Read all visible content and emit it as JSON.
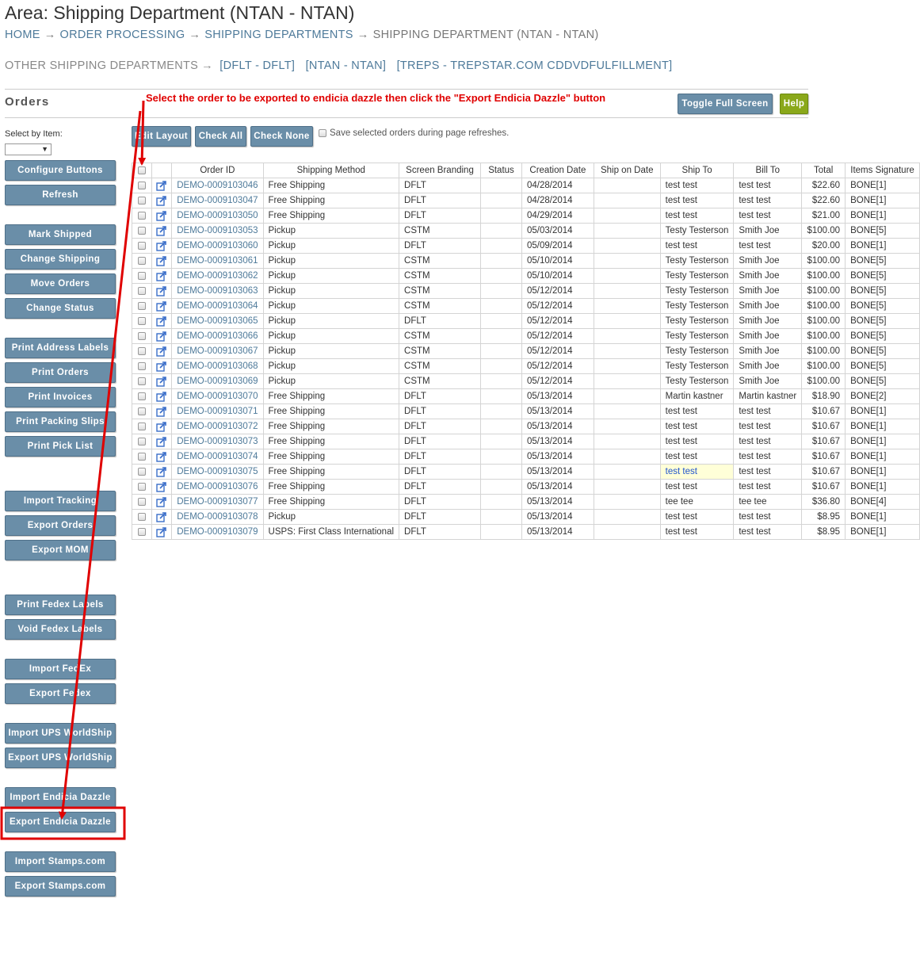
{
  "page": {
    "title": "Area: Shipping Department (NTAN - NTAN)",
    "breadcrumb": [
      "HOME",
      "ORDER PROCESSING",
      "SHIPPING DEPARTMENTS",
      "SHIPPING DEPARTMENT (NTAN - NTAN)"
    ],
    "separator": "→"
  },
  "other_departments": {
    "label": "OTHER SHIPPING DEPARTMENTS",
    "items": [
      "[DFLT - DFLT]",
      "[NTAN - NTAN]",
      "[TREPS - TREPSTAR.COM CDDVDFULFILLMENT]"
    ]
  },
  "orders_heading": "Orders",
  "instruction": "Select the order to be exported to endicia dazzle then click the \"Export Endicia Dazzle\" button",
  "top_buttons": {
    "toggle_full_screen": "Toggle Full Screen",
    "help": "Help"
  },
  "select_by_item": {
    "label": "Select by Item:",
    "value": ""
  },
  "toolbar": {
    "edit_layout": "Edit Layout",
    "check_all": "Check All",
    "check_none": "Check None",
    "save_selected": "Save selected orders during page refreshes."
  },
  "sidebar": {
    "configure_buttons": "Configure Buttons",
    "refresh": "Refresh",
    "mark_shipped": "Mark Shipped",
    "change_shipping": "Change Shipping",
    "move_orders": "Move Orders",
    "change_status": "Change Status",
    "print_address_labels": "Print Address Labels",
    "print_orders": "Print Orders",
    "print_invoices": "Print Invoices",
    "print_packing_slips": "Print Packing Slips",
    "print_pick_list": "Print Pick List",
    "import_tracking": "Import Tracking",
    "export_orders": "Export Orders",
    "export_mom": "Export MOM",
    "print_fedex_labels": "Print Fedex Labels",
    "void_fedex_labels": "Void Fedex Labels",
    "import_fedex": "Import FedEx",
    "export_fedex": "Export Fedex",
    "import_ups_worldship": "Import UPS WorldShip",
    "export_ups_worldship": "Export UPS WorldShip",
    "import_endicia_dazzle": "Import Endicia Dazzle",
    "export_endicia_dazzle": "Export Endicia Dazzle",
    "import_stamps": "Import Stamps.com",
    "export_stamps": "Export Stamps.com"
  },
  "table": {
    "columns": [
      "Order ID",
      "Shipping Method",
      "Screen Branding",
      "Status",
      "Creation Date",
      "Ship on Date",
      "Ship To",
      "Bill To",
      "Total",
      "Items Signature"
    ],
    "rows": [
      [
        "DEMO-0009103046",
        "Free Shipping",
        "DFLT",
        "",
        "04/28/2014",
        "",
        "test test",
        "test test",
        "$22.60",
        "BONE[1]"
      ],
      [
        "DEMO-0009103047",
        "Free Shipping",
        "DFLT",
        "",
        "04/28/2014",
        "",
        "test test",
        "test test",
        "$22.60",
        "BONE[1]"
      ],
      [
        "DEMO-0009103050",
        "Free Shipping",
        "DFLT",
        "",
        "04/29/2014",
        "",
        "test test",
        "test test",
        "$21.00",
        "BONE[1]"
      ],
      [
        "DEMO-0009103053",
        "Pickup",
        "CSTM",
        "",
        "05/03/2014",
        "",
        "Testy Testerson",
        "Smith Joe",
        "$100.00",
        "BONE[5]"
      ],
      [
        "DEMO-0009103060",
        "Pickup",
        "DFLT",
        "",
        "05/09/2014",
        "",
        "test test",
        "test test",
        "$20.00",
        "BONE[1]"
      ],
      [
        "DEMO-0009103061",
        "Pickup",
        "CSTM",
        "",
        "05/10/2014",
        "",
        "Testy Testerson",
        "Smith Joe",
        "$100.00",
        "BONE[5]"
      ],
      [
        "DEMO-0009103062",
        "Pickup",
        "CSTM",
        "",
        "05/10/2014",
        "",
        "Testy Testerson",
        "Smith Joe",
        "$100.00",
        "BONE[5]"
      ],
      [
        "DEMO-0009103063",
        "Pickup",
        "CSTM",
        "",
        "05/12/2014",
        "",
        "Testy Testerson",
        "Smith Joe",
        "$100.00",
        "BONE[5]"
      ],
      [
        "DEMO-0009103064",
        "Pickup",
        "CSTM",
        "",
        "05/12/2014",
        "",
        "Testy Testerson",
        "Smith Joe",
        "$100.00",
        "BONE[5]"
      ],
      [
        "DEMO-0009103065",
        "Pickup",
        "DFLT",
        "",
        "05/12/2014",
        "",
        "Testy Testerson",
        "Smith Joe",
        "$100.00",
        "BONE[5]"
      ],
      [
        "DEMO-0009103066",
        "Pickup",
        "CSTM",
        "",
        "05/12/2014",
        "",
        "Testy Testerson",
        "Smith Joe",
        "$100.00",
        "BONE[5]"
      ],
      [
        "DEMO-0009103067",
        "Pickup",
        "CSTM",
        "",
        "05/12/2014",
        "",
        "Testy Testerson",
        "Smith Joe",
        "$100.00",
        "BONE[5]"
      ],
      [
        "DEMO-0009103068",
        "Pickup",
        "CSTM",
        "",
        "05/12/2014",
        "",
        "Testy Testerson",
        "Smith Joe",
        "$100.00",
        "BONE[5]"
      ],
      [
        "DEMO-0009103069",
        "Pickup",
        "CSTM",
        "",
        "05/12/2014",
        "",
        "Testy Testerson",
        "Smith Joe",
        "$100.00",
        "BONE[5]"
      ],
      [
        "DEMO-0009103070",
        "Free Shipping",
        "DFLT",
        "",
        "05/13/2014",
        "",
        "Martin kastner",
        "Martin kastner",
        "$18.90",
        "BONE[2]"
      ],
      [
        "DEMO-0009103071",
        "Free Shipping",
        "DFLT",
        "",
        "05/13/2014",
        "",
        "test test",
        "test test",
        "$10.67",
        "BONE[1]"
      ],
      [
        "DEMO-0009103072",
        "Free Shipping",
        "DFLT",
        "",
        "05/13/2014",
        "",
        "test test",
        "test test",
        "$10.67",
        "BONE[1]"
      ],
      [
        "DEMO-0009103073",
        "Free Shipping",
        "DFLT",
        "",
        "05/13/2014",
        "",
        "test test",
        "test test",
        "$10.67",
        "BONE[1]"
      ],
      [
        "DEMO-0009103074",
        "Free Shipping",
        "DFLT",
        "",
        "05/13/2014",
        "",
        "test test",
        "test test",
        "$10.67",
        "BONE[1]"
      ],
      [
        "DEMO-0009103075",
        "Free Shipping",
        "DFLT",
        "",
        "05/13/2014",
        "",
        "test test",
        "test test",
        "$10.67",
        "BONE[1]"
      ],
      [
        "DEMO-0009103076",
        "Free Shipping",
        "DFLT",
        "",
        "05/13/2014",
        "",
        "test test",
        "test test",
        "$10.67",
        "BONE[1]"
      ],
      [
        "DEMO-0009103077",
        "Free Shipping",
        "DFLT",
        "",
        "05/13/2014",
        "",
        "tee tee",
        "tee tee",
        "$36.80",
        "BONE[4]"
      ],
      [
        "DEMO-0009103078",
        "Pickup",
        "DFLT",
        "",
        "05/13/2014",
        "",
        "test test",
        "test test",
        "$8.95",
        "BONE[1]"
      ],
      [
        "DEMO-0009103079",
        "USPS: First Class International",
        "DFLT",
        "",
        "05/13/2014",
        "",
        "test test",
        "test test",
        "$8.95",
        "BONE[1]"
      ]
    ],
    "highlighted_row_index": 19
  },
  "colors": {
    "button": "#6a8ea8",
    "help_button": "#8aa81a",
    "link": "#4e7a9a",
    "annotation": "#e00000",
    "highlight_cell": "#ffffd8"
  },
  "icons": [
    "external-link-icon",
    "checkbox",
    "dropdown-arrow-icon",
    "right-arrow-icon"
  ]
}
